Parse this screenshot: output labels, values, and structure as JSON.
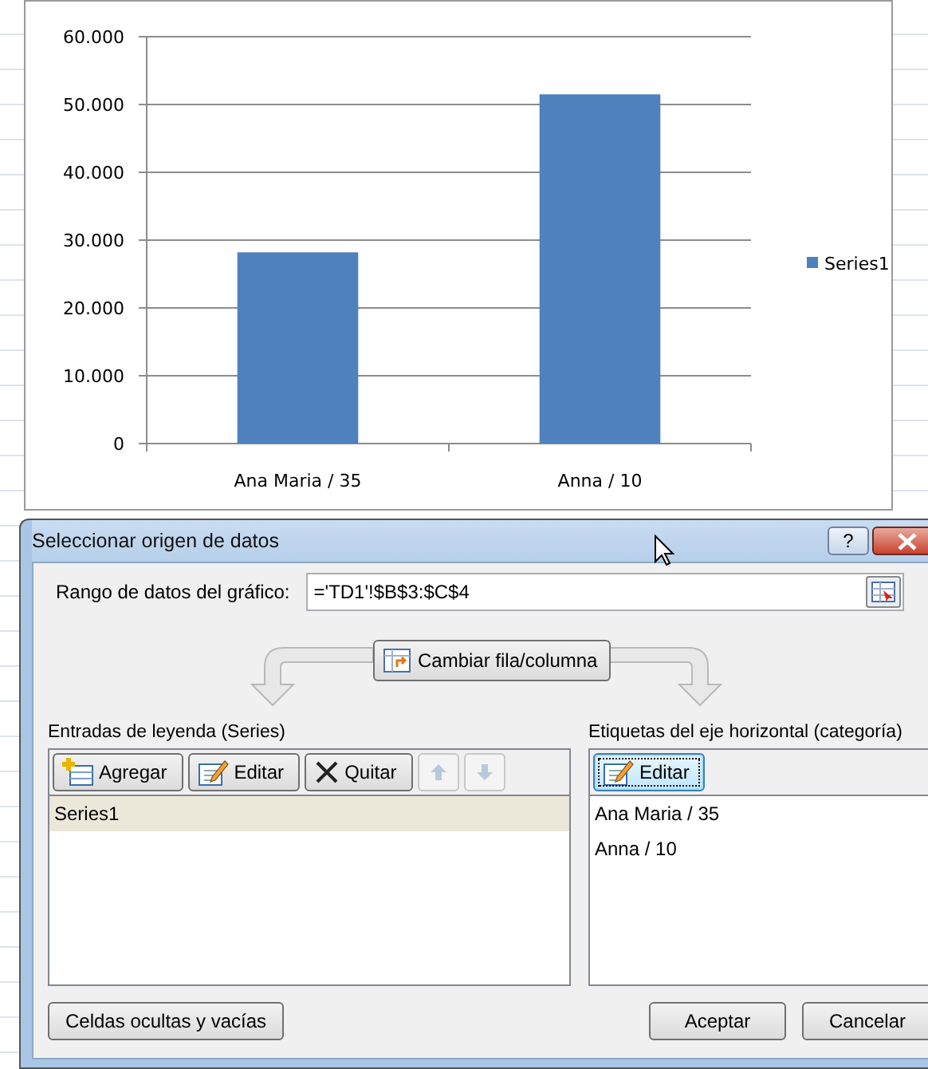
{
  "chart": {
    "chart_data": {
      "type": "bar",
      "grid": true,
      "categories": [
        "Ana Maria / 35",
        "Anna / 10"
      ],
      "series": [
        {
          "name": "Series1",
          "color": "#4f81bd",
          "values": [
            28200,
            51500
          ]
        }
      ],
      "ylim": [
        0,
        60000
      ],
      "yticks": [
        {
          "value": 0,
          "label": "0"
        },
        {
          "value": 10000,
          "label": "10.000"
        },
        {
          "value": 20000,
          "label": "20.000"
        },
        {
          "value": 30000,
          "label": "30.000"
        },
        {
          "value": 40000,
          "label": "40.000"
        },
        {
          "value": 50000,
          "label": "50.000"
        },
        {
          "value": 60000,
          "label": "60.000"
        }
      ]
    }
  },
  "dialog": {
    "title": "Seleccionar origen de datos",
    "help_button": "?",
    "range": {
      "label": "Rango de datos del gráfico:",
      "value": "='TD1'!$B$3:$C$4"
    },
    "switch_button": "Cambiar fila/columna",
    "legend_pane": {
      "heading": "Entradas de leyenda (Series)",
      "buttons": [
        {
          "kind": "add",
          "label": "Agregar",
          "disabled": false,
          "focused": false
        },
        {
          "kind": "edit",
          "label": "Editar",
          "disabled": false,
          "focused": false
        },
        {
          "kind": "remove",
          "label": "Quitar",
          "disabled": false,
          "focused": false
        },
        {
          "kind": "up",
          "disabled": true,
          "focused": false
        },
        {
          "kind": "down",
          "disabled": true,
          "focused": false
        }
      ],
      "items": [
        {
          "label": "Series1",
          "selected": true
        }
      ]
    },
    "axis_pane": {
      "heading": "Etiquetas del eje horizontal (categoría)",
      "buttons": [
        {
          "kind": "edit",
          "label": "Editar",
          "disabled": false,
          "focused": true
        }
      ],
      "items": [
        {
          "label": "Ana Maria / 35",
          "selected": false
        },
        {
          "label": "Anna / 10",
          "selected": false
        }
      ]
    },
    "footer_buttons": [
      "Celdas ocultas y vacías",
      "Aceptar",
      "Cancelar"
    ]
  }
}
